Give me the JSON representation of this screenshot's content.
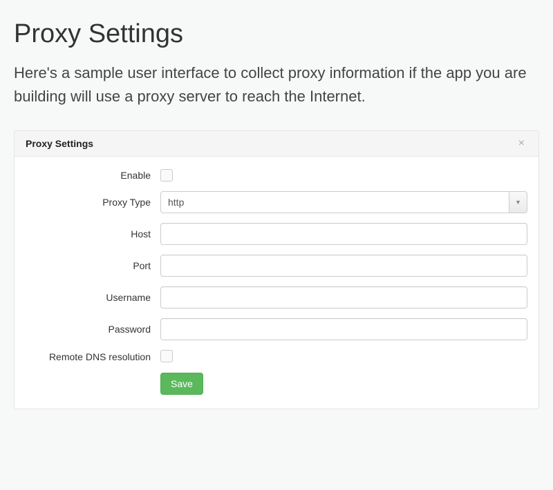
{
  "page": {
    "title": "Proxy Settings",
    "description": "Here's a sample user interface to collect proxy information if the app you are building will use a proxy server to reach the Internet."
  },
  "panel": {
    "title": "Proxy Settings"
  },
  "form": {
    "enable": {
      "label": "Enable",
      "value": false
    },
    "proxy_type": {
      "label": "Proxy Type",
      "value": "http"
    },
    "host": {
      "label": "Host",
      "value": ""
    },
    "port": {
      "label": "Port",
      "value": ""
    },
    "username": {
      "label": "Username",
      "value": ""
    },
    "password": {
      "label": "Password",
      "value": ""
    },
    "remote_dns": {
      "label": "Remote DNS resolution",
      "value": false
    },
    "save_label": "Save"
  }
}
